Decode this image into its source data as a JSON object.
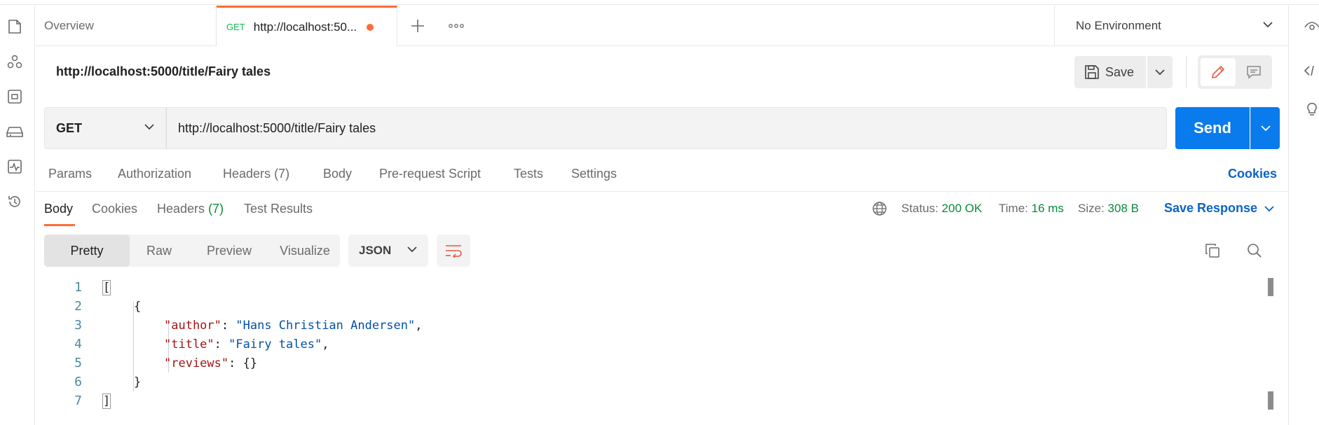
{
  "tabs": {
    "overview_label": "Overview",
    "active_method": "GET",
    "active_label": "http://localhost:50..."
  },
  "environment": {
    "selected": "No Environment"
  },
  "request": {
    "title": "http://localhost:5000/title/Fairy tales",
    "save_label": "Save",
    "method": "GET",
    "url": "http://localhost:5000/title/Fairy tales",
    "send_label": "Send"
  },
  "request_tabs": {
    "params": "Params",
    "authorization": "Authorization",
    "headers": "Headers",
    "headers_count": "(7)",
    "body": "Body",
    "pre_request": "Pre-request Script",
    "tests": "Tests",
    "settings": "Settings",
    "cookies": "Cookies"
  },
  "response_tabs": {
    "body": "Body",
    "cookies": "Cookies",
    "headers": "Headers",
    "headers_count": "(7)",
    "test_results": "Test Results"
  },
  "response_meta": {
    "status_label": "Status:",
    "status_value": "200 OK",
    "time_label": "Time:",
    "time_value": "16 ms",
    "size_label": "Size:",
    "size_value": "308 B",
    "save_response": "Save Response"
  },
  "view_modes": {
    "pretty": "Pretty",
    "raw": "Raw",
    "preview": "Preview",
    "visualize": "Visualize",
    "format": "JSON"
  },
  "body_lines": [
    {
      "n": "1",
      "text": "["
    },
    {
      "n": "2",
      "text": "{"
    },
    {
      "n": "3",
      "key": "\"author\"",
      "sep": ": ",
      "value": "\"Hans Christian Andersen\"",
      "tail": ","
    },
    {
      "n": "4",
      "key": "\"title\"",
      "sep": ": ",
      "value": "\"Fairy tales\"",
      "tail": ","
    },
    {
      "n": "5",
      "key": "\"reviews\"",
      "sep": ": ",
      "tail": "{}"
    },
    {
      "n": "6",
      "text": "}"
    },
    {
      "n": "7",
      "text": "]"
    }
  ],
  "colors": {
    "accent": "#ff6c37",
    "send": "#097bed",
    "link": "#0b63c7",
    "success": "#0a8a3b"
  }
}
